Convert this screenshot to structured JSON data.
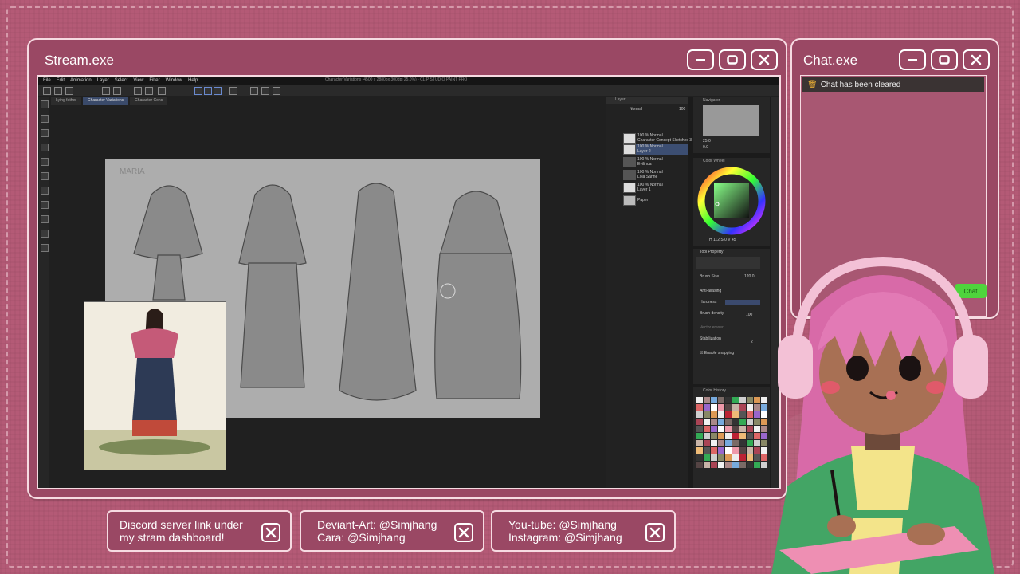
{
  "stream_window": {
    "title": "Stream.exe"
  },
  "chat_window": {
    "title": "Chat.exe",
    "message": "Chat has been cleared",
    "chat_button": "Chat"
  },
  "app": {
    "title": "Character Variations (4500 x 2880px 300dpi 25.0%) - CLIP STUDIO PAINT PRO",
    "menu": [
      "File",
      "Edit",
      "Animation",
      "Layer",
      "Select",
      "View",
      "Filter",
      "Window",
      "Help"
    ],
    "tabs": [
      "Lying father",
      "Character Variations",
      "Character Conc"
    ],
    "canvas_label": "MARIA",
    "layers": [
      {
        "mode": "100 % Normal",
        "name": "Character Concept Sketches 3"
      },
      {
        "mode": "100 % Normal",
        "name": "Layer 2"
      },
      {
        "mode": "100 % Normal",
        "name": "Evilinda"
      },
      {
        "mode": "100 % Normal",
        "name": "Lola Sanne"
      },
      {
        "mode": "100 % Normal",
        "name": "Layer 1"
      },
      {
        "mode": "",
        "name": "Paper"
      }
    ],
    "layer_blend": "Normal",
    "layer_opacity": "100",
    "nav_zoom": "25.0",
    "nav_angle": "0.0",
    "panel_labels": {
      "layer": "Layer",
      "navigator": "Navigator",
      "color_wheel": "Color Wheel",
      "tool_property": "Tool Property",
      "color_history": "Color History"
    },
    "tool_property": {
      "brush_size_label": "Brush Size",
      "brush_size": "120.0",
      "anti_aliasing": "Anti-aliasing",
      "hardness": "Hardness",
      "brush_density_label": "Brush density",
      "brush_density": "100",
      "vector_eraser": "Vector eraser",
      "stabilization_label": "Stabilization",
      "stabilization": "2",
      "snapping": "Enable snapping"
    },
    "hsv": {
      "h": "112",
      "s": "0",
      "v": "45"
    }
  },
  "info_boxes": [
    {
      "line1": "Discord server link under",
      "line2": "my stram dashboard!"
    },
    {
      "line1": "Deviant-Art: @Simjhang",
      "line2": "Cara: @Simjhang"
    },
    {
      "line1": "You-tube: @Simjhang",
      "line2": "Instagram: @Simjhang"
    }
  ],
  "colors": {
    "frame": "#9a4864",
    "border": "#f6dbe2",
    "background": "#b45a76",
    "chat_button": "#4fd43c"
  }
}
